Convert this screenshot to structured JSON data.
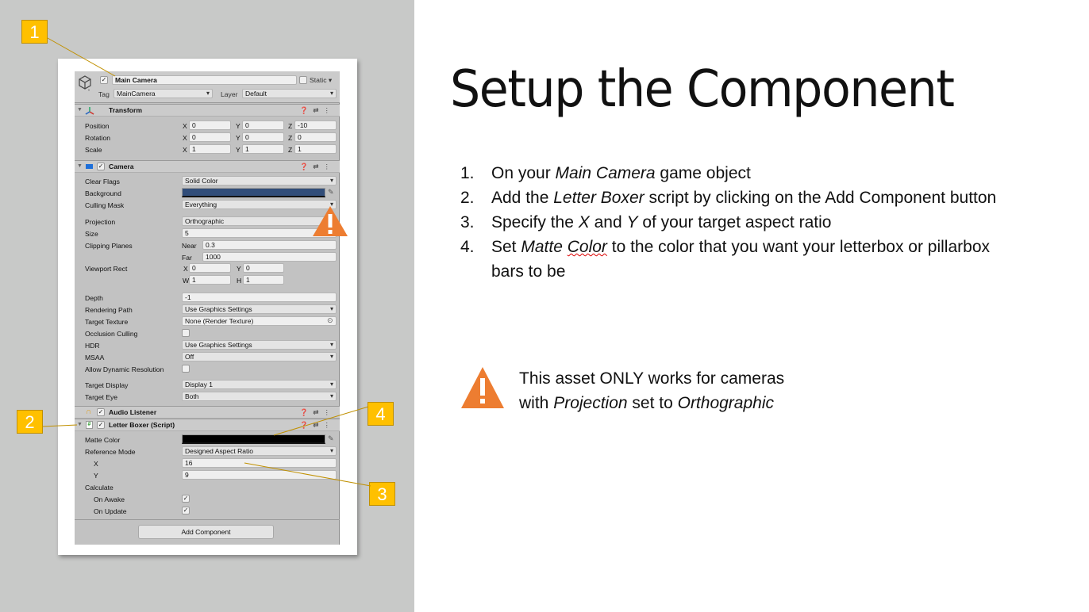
{
  "slide": {
    "title": "Setup the Component",
    "steps": [
      {
        "num": "1.",
        "parts": [
          {
            "t": "On your ",
            "i": false
          },
          {
            "t": "Main Camera",
            "i": true
          },
          {
            "t": " game object",
            "i": false
          }
        ]
      },
      {
        "num": "2.",
        "parts": [
          {
            "t": "Add the ",
            "i": false
          },
          {
            "t": "Letter Boxer",
            "i": true
          },
          {
            "t": " script by clicking on the Add Component button",
            "i": false
          }
        ]
      },
      {
        "num": "3.",
        "parts": [
          {
            "t": "Specify the ",
            "i": false
          },
          {
            "t": "X",
            "i": true
          },
          {
            "t": "  and ",
            "i": false
          },
          {
            "t": "Y",
            "i": true
          },
          {
            "t": " of your target aspect ratio",
            "i": false
          }
        ]
      },
      {
        "num": "4.",
        "parts": [
          {
            "t": "Set ",
            "i": false
          },
          {
            "t": "Matte ",
            "i": true
          },
          {
            "t": "Color",
            "i": true,
            "squiggle": true
          },
          {
            "t": " to the color that you want your letterbox or pillarbox bars to be",
            "i": false
          }
        ]
      }
    ],
    "warning": {
      "line1": "This asset ONLY works for cameras",
      "line2_parts": [
        {
          "t": "with ",
          "i": false
        },
        {
          "t": "Projection",
          "i": true
        },
        {
          "t": " set to ",
          "i": false
        },
        {
          "t": "Orthographic",
          "i": true
        }
      ]
    },
    "callouts": [
      "1",
      "2",
      "3",
      "4"
    ],
    "colors": {
      "callout": "#ffc000",
      "warning": "#ed7d31",
      "leader": "#c09000"
    }
  },
  "inspector": {
    "object_name": "Main Camera",
    "active_check": "✓",
    "static_label": "Static",
    "tag_label": "Tag",
    "tag_value": "MainCamera",
    "layer_label": "Layer",
    "layer_value": "Default",
    "transform": {
      "title": "Transform",
      "rows": [
        {
          "label": "Position",
          "x": "0",
          "y": "0",
          "z": "-10"
        },
        {
          "label": "Rotation",
          "x": "0",
          "y": "0",
          "z": "0"
        },
        {
          "label": "Scale",
          "x": "1",
          "y": "1",
          "z": "1"
        }
      ]
    },
    "camera": {
      "title": "Camera",
      "clear_flags_label": "Clear Flags",
      "clear_flags": "Solid Color",
      "background_label": "Background",
      "background_color": "#314d79",
      "culling_mask_label": "Culling Mask",
      "culling_mask": "Everything",
      "projection_label": "Projection",
      "projection": "Orthographic",
      "size_label": "Size",
      "size": "5",
      "clipping_label": "Clipping Planes",
      "near_label": "Near",
      "near": "0.3",
      "far_label": "Far",
      "far": "1000",
      "viewport_label": "Viewport Rect",
      "vx": "0",
      "vy": "0",
      "vw": "1",
      "vh": "1",
      "depth_label": "Depth",
      "depth": "-1",
      "rendering_path_label": "Rendering Path",
      "rendering_path": "Use Graphics Settings",
      "target_texture_label": "Target Texture",
      "target_texture": "None (Render Texture)",
      "occlusion_label": "Occlusion Culling",
      "hdr_label": "HDR",
      "hdr": "Use Graphics Settings",
      "msaa_label": "MSAA",
      "msaa": "Off",
      "dynamic_res_label": "Allow Dynamic Resolution",
      "target_display_label": "Target Display",
      "target_display": "Display 1",
      "target_eye_label": "Target Eye",
      "target_eye": "Both"
    },
    "audio_listener": {
      "title": "Audio Listener"
    },
    "letter_boxer": {
      "title": "Letter Boxer (Script)",
      "matte_label": "Matte Color",
      "matte_color": "#000000",
      "ref_mode_label": "Reference Mode",
      "ref_mode": "Designed Aspect Ratio",
      "x_label": "X",
      "x": "16",
      "y_label": "Y",
      "y": "9",
      "calculate_label": "Calculate",
      "on_awake_label": "On Awake",
      "on_awake": "✓",
      "on_update_label": "On Update",
      "on_update": "✓"
    },
    "add_component": "Add Component",
    "axis": {
      "x": "X",
      "y": "Y",
      "z": "Z",
      "w": "W",
      "h": "H"
    }
  }
}
